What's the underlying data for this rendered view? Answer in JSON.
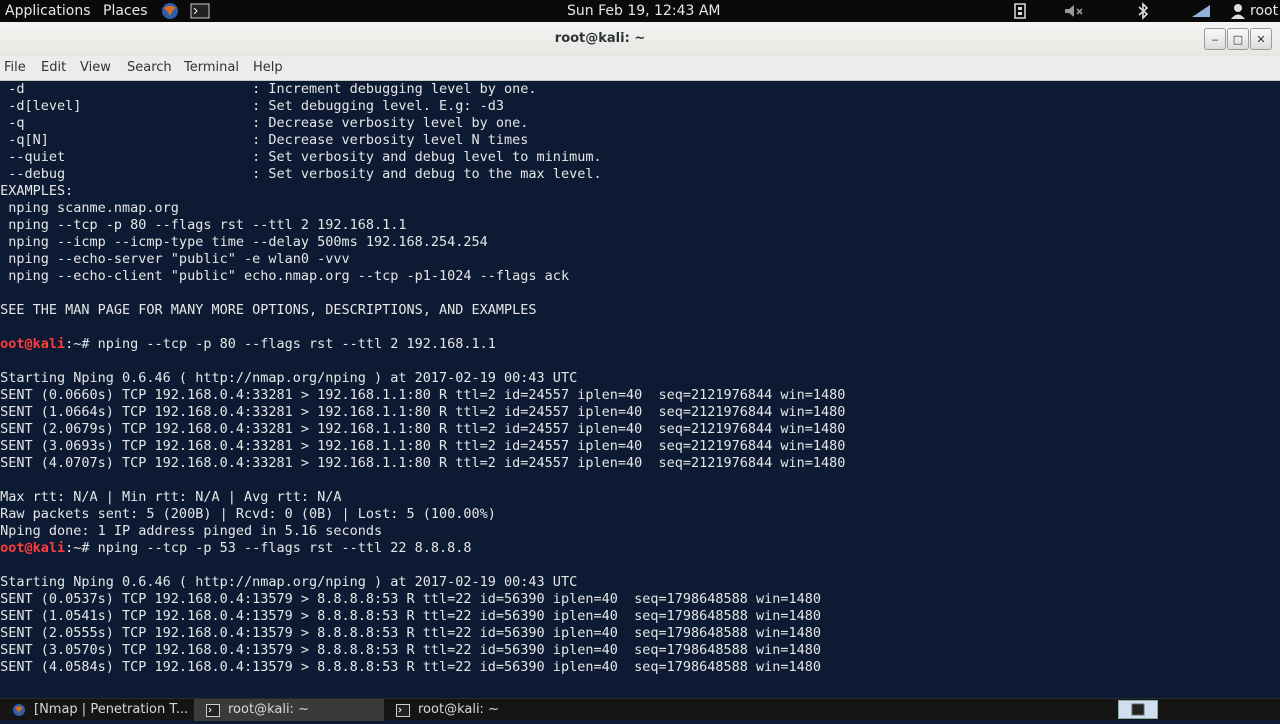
{
  "top_panel": {
    "applications": "Applications",
    "places": "Places",
    "clock": "Sun Feb 19, 12:43 AM",
    "user": "root"
  },
  "window": {
    "title": "root@kali: ~",
    "minimize": "‒",
    "maximize": "□",
    "close": "✕"
  },
  "menu": [
    "File",
    "Edit",
    "View",
    "Search",
    "Terminal",
    "Help"
  ],
  "terminal": {
    "lines": [
      {
        "text": "  -d                            : Increment debugging level by one."
      },
      {
        "text": "  -d[level]                     : Set debugging level. E.g: -d3"
      },
      {
        "text": "  -q                            : Decrease verbosity level by one."
      },
      {
        "text": "  -q[N]                         : Decrease verbosity level N times"
      },
      {
        "text": "  --quiet                       : Set verbosity and debug level to minimum."
      },
      {
        "text": "  --debug                       : Set verbosity and debug to the max level."
      },
      {
        "text": " EXAMPLES:"
      },
      {
        "text": "  nping scanme.nmap.org"
      },
      {
        "text": "  nping --tcp -p 80 --flags rst --ttl 2 192.168.1.1"
      },
      {
        "text": "  nping --icmp --icmp-type time --delay 500ms 192.168.254.254"
      },
      {
        "text": "  nping --echo-server \"public\" -e wlan0 -vvv"
      },
      {
        "text": "  nping --echo-client \"public\" echo.nmap.org --tcp -p1-1024 --flags ack"
      },
      {
        "text": ""
      },
      {
        "text": " SEE THE MAN PAGE FOR MANY MORE OPTIONS, DESCRIPTIONS, AND EXAMPLES"
      },
      {
        "text": ""
      },
      {
        "prompt": "root@kali",
        "text": ":~# nping --tcp -p 80 --flags rst --ttl 2 192.168.1.1"
      },
      {
        "text": ""
      },
      {
        "text": " Starting Nping 0.6.46 ( http://nmap.org/nping ) at 2017-02-19 00:43 UTC"
      },
      {
        "text": " SENT (0.0660s) TCP 192.168.0.4:33281 > 192.168.1.1:80 R ttl=2 id=24557 iplen=40  seq=2121976844 win=1480"
      },
      {
        "text": " SENT (1.0664s) TCP 192.168.0.4:33281 > 192.168.1.1:80 R ttl=2 id=24557 iplen=40  seq=2121976844 win=1480"
      },
      {
        "text": " SENT (2.0679s) TCP 192.168.0.4:33281 > 192.168.1.1:80 R ttl=2 id=24557 iplen=40  seq=2121976844 win=1480"
      },
      {
        "text": " SENT (3.0693s) TCP 192.168.0.4:33281 > 192.168.1.1:80 R ttl=2 id=24557 iplen=40  seq=2121976844 win=1480"
      },
      {
        "text": " SENT (4.0707s) TCP 192.168.0.4:33281 > 192.168.1.1:80 R ttl=2 id=24557 iplen=40  seq=2121976844 win=1480"
      },
      {
        "text": ""
      },
      {
        "text": " Max rtt: N/A | Min rtt: N/A | Avg rtt: N/A"
      },
      {
        "text": " Raw packets sent: 5 (200B) | Rcvd: 0 (0B) | Lost: 5 (100.00%)"
      },
      {
        "text": " Nping done: 1 IP address pinged in 5.16 seconds"
      },
      {
        "prompt": "root@kali",
        "text": ":~# nping --tcp -p 53 --flags rst --ttl 22 8.8.8.8"
      },
      {
        "text": ""
      },
      {
        "text": " Starting Nping 0.6.46 ( http://nmap.org/nping ) at 2017-02-19 00:43 UTC"
      },
      {
        "text": " SENT (0.0537s) TCP 192.168.0.4:13579 > 8.8.8.8:53 R ttl=22 id=56390 iplen=40  seq=1798648588 win=1480"
      },
      {
        "text": " SENT (1.0541s) TCP 192.168.0.4:13579 > 8.8.8.8:53 R ttl=22 id=56390 iplen=40  seq=1798648588 win=1480"
      },
      {
        "text": " SENT (2.0555s) TCP 192.168.0.4:13579 > 8.8.8.8:53 R ttl=22 id=56390 iplen=40  seq=1798648588 win=1480"
      },
      {
        "text": " SENT (3.0570s) TCP 192.168.0.4:13579 > 8.8.8.8:53 R ttl=22 id=56390 iplen=40  seq=1798648588 win=1480"
      },
      {
        "text": " SENT (4.0584s) TCP 192.168.0.4:13579 > 8.8.8.8:53 R ttl=22 id=56390 iplen=40  seq=1798648588 win=1480"
      }
    ]
  },
  "taskbar": {
    "tasks": [
      {
        "label": "[Nmap | Penetration T...",
        "icon": "browser-icon"
      },
      {
        "label": "root@kali: ~",
        "icon": "terminal-icon"
      },
      {
        "label": "root@kali: ~",
        "icon": "terminal-icon"
      }
    ]
  },
  "colors": {
    "terminal_bg": "#0c1b33",
    "terminal_fg": "#e6e6e6",
    "prompt_user": "#ff3b3b"
  },
  "icons": [
    "browser-icon",
    "terminal-icon",
    "network-icon",
    "speaker-muted-icon",
    "bluetooth-icon",
    "battery-icon",
    "user-icon"
  ]
}
